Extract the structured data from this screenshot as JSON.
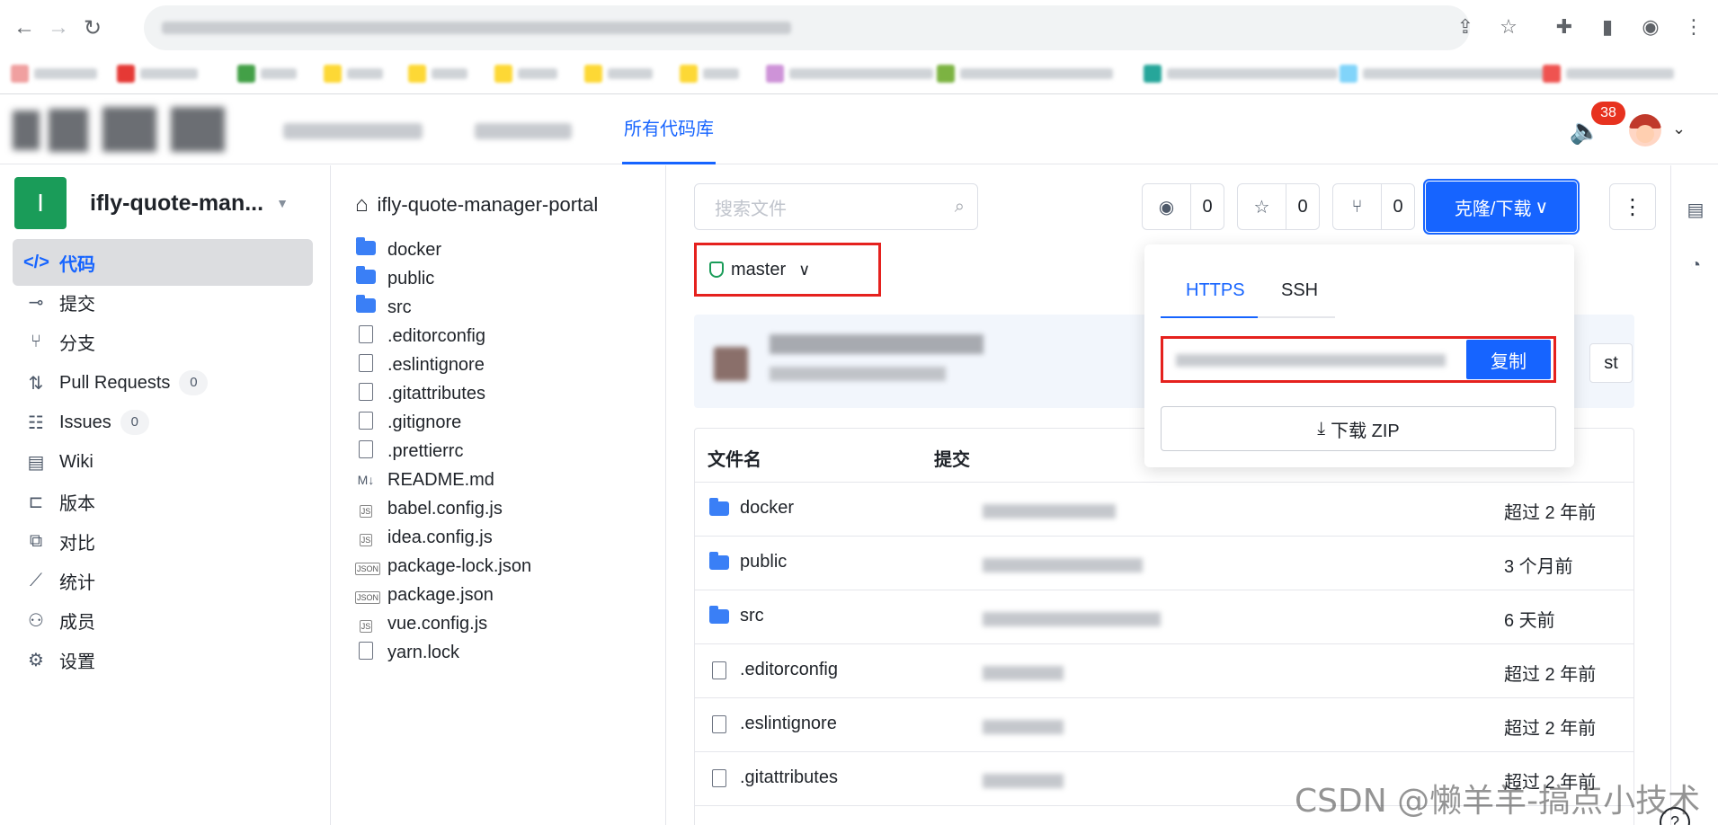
{
  "app": {
    "header_tab": "所有代码库",
    "notification_count": "38"
  },
  "repo": {
    "avatar_letter": "I",
    "name": "ifly-quote-man..."
  },
  "sidebar": {
    "items": [
      {
        "label": "代码",
        "icon": "code-icon"
      },
      {
        "label": "提交",
        "icon": "commit-icon"
      },
      {
        "label": "分支",
        "icon": "branch-icon"
      },
      {
        "label": "Pull Requests",
        "icon": "pull-request-icon",
        "count": "0"
      },
      {
        "label": "Issues",
        "icon": "issues-icon",
        "count": "0"
      },
      {
        "label": "Wiki",
        "icon": "wiki-icon"
      },
      {
        "label": "版本",
        "icon": "release-icon"
      },
      {
        "label": "对比",
        "icon": "compare-icon"
      },
      {
        "label": "统计",
        "icon": "stats-icon"
      },
      {
        "label": "成员",
        "icon": "members-icon"
      },
      {
        "label": "设置",
        "icon": "settings-icon"
      }
    ]
  },
  "tree": {
    "root": "ifly-quote-manager-portal",
    "items": [
      {
        "name": "docker",
        "type": "folder"
      },
      {
        "name": "public",
        "type": "folder"
      },
      {
        "name": "src",
        "type": "folder"
      },
      {
        "name": ".editorconfig",
        "type": "file"
      },
      {
        "name": ".eslintignore",
        "type": "file"
      },
      {
        "name": ".gitattributes",
        "type": "file"
      },
      {
        "name": ".gitignore",
        "type": "file"
      },
      {
        "name": ".prettierrc",
        "type": "file"
      },
      {
        "name": "README.md",
        "type": "markdown"
      },
      {
        "name": "babel.config.js",
        "type": "js"
      },
      {
        "name": "idea.config.js",
        "type": "js"
      },
      {
        "name": "package-lock.json",
        "type": "json"
      },
      {
        "name": "package.json",
        "type": "json"
      },
      {
        "name": "vue.config.js",
        "type": "js"
      },
      {
        "name": "yarn.lock",
        "type": "file"
      }
    ]
  },
  "main": {
    "search_placeholder": "搜索文件",
    "watch_count": "0",
    "star_count": "0",
    "fork_count": "0",
    "clone_label": "克隆/下载",
    "branch": "master",
    "commit_button_partial": "st",
    "table": {
      "col_name": "文件名",
      "col_commit": "提交",
      "rows": [
        {
          "name": "docker",
          "type": "folder",
          "time": "超过 2 年前"
        },
        {
          "name": "public",
          "type": "folder",
          "time": "3 个月前"
        },
        {
          "name": "src",
          "type": "folder",
          "time": "6 天前"
        },
        {
          "name": ".editorconfig",
          "type": "file",
          "time": "超过 2 年前"
        },
        {
          "name": ".eslintignore",
          "type": "file",
          "time": "超过 2 年前"
        },
        {
          "name": ".gitattributes",
          "type": "file",
          "time": "超过 2 年前"
        }
      ]
    }
  },
  "clone_popover": {
    "tab_https": "HTTPS",
    "tab_ssh": "SSH",
    "copy_label": "复制",
    "zip_label": "下载 ZIP"
  },
  "watermark": "CSDN @懒羊羊-搞点小技术",
  "colors": {
    "accent": "#1664ff",
    "highlight_border": "#e5211e",
    "repo_avatar": "#1a9c59",
    "badge": "#e7321f"
  }
}
